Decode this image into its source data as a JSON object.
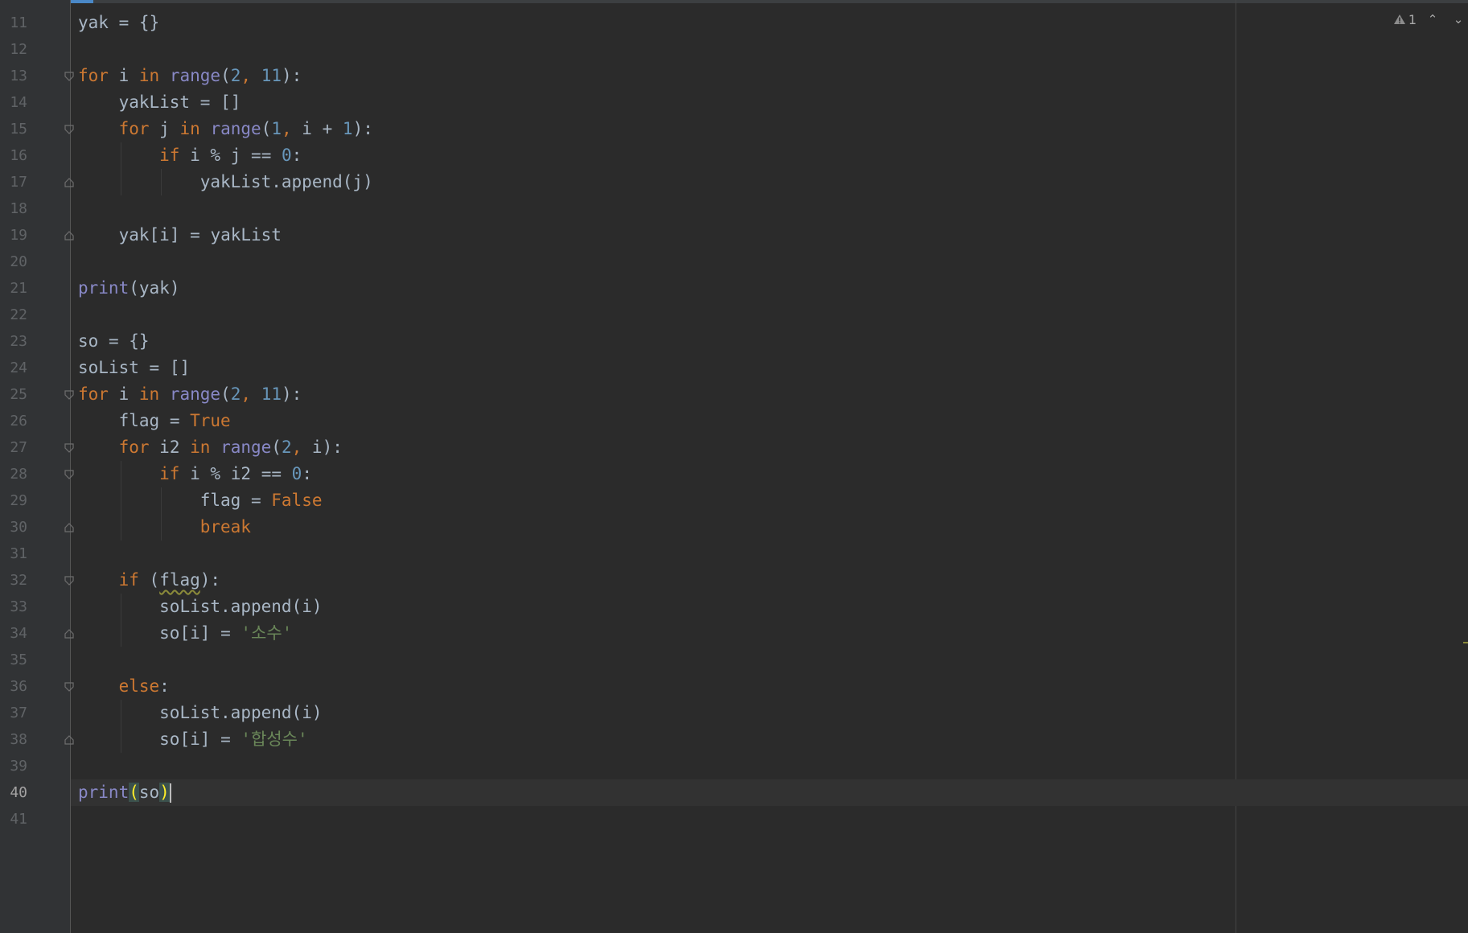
{
  "editor": {
    "language": "python",
    "current_line": 40,
    "inspection": {
      "warnings": "1",
      "warning_icon": "warning-triangle-icon",
      "prev_icon": "chevron-up-icon",
      "next_icon": "chevron-down-icon"
    },
    "lines": [
      {
        "n": "11",
        "text": "yak = {}"
      },
      {
        "n": "12",
        "text": ""
      },
      {
        "n": "13",
        "text": "for i in range(2, 11):"
      },
      {
        "n": "14",
        "text": "    yakList = []"
      },
      {
        "n": "15",
        "text": "    for j in range(1, i + 1):"
      },
      {
        "n": "16",
        "text": "        if i % j == 0:"
      },
      {
        "n": "17",
        "text": "            yakList.append(j)"
      },
      {
        "n": "18",
        "text": ""
      },
      {
        "n": "19",
        "text": "    yak[i] = yakList"
      },
      {
        "n": "20",
        "text": ""
      },
      {
        "n": "21",
        "text": "print(yak)"
      },
      {
        "n": "22",
        "text": ""
      },
      {
        "n": "23",
        "text": "so = {}"
      },
      {
        "n": "24",
        "text": "soList = []"
      },
      {
        "n": "25",
        "text": "for i in range(2, 11):"
      },
      {
        "n": "26",
        "text": "    flag = True"
      },
      {
        "n": "27",
        "text": "    for i2 in range(2, i):"
      },
      {
        "n": "28",
        "text": "        if i % i2 == 0:"
      },
      {
        "n": "29",
        "text": "            flag = False"
      },
      {
        "n": "30",
        "text": "            break"
      },
      {
        "n": "31",
        "text": ""
      },
      {
        "n": "32",
        "text": "    if (flag):"
      },
      {
        "n": "33",
        "text": "        soList.append(i)"
      },
      {
        "n": "34",
        "text": "        so[i] = '소수'"
      },
      {
        "n": "35",
        "text": ""
      },
      {
        "n": "36",
        "text": "    else:"
      },
      {
        "n": "37",
        "text": "        soList.append(i)"
      },
      {
        "n": "38",
        "text": "        so[i] = '합성수'"
      },
      {
        "n": "39",
        "text": ""
      },
      {
        "n": "40",
        "text": "print(so)"
      },
      {
        "n": "41",
        "text": ""
      }
    ]
  },
  "colors": {
    "background": "#2b2b2b",
    "gutter": "#313335",
    "keyword": "#cc7832",
    "number": "#6897bb",
    "builtin": "#8888c6",
    "string": "#6a8759",
    "text": "#a9b7c6",
    "current_line": "#323232"
  }
}
